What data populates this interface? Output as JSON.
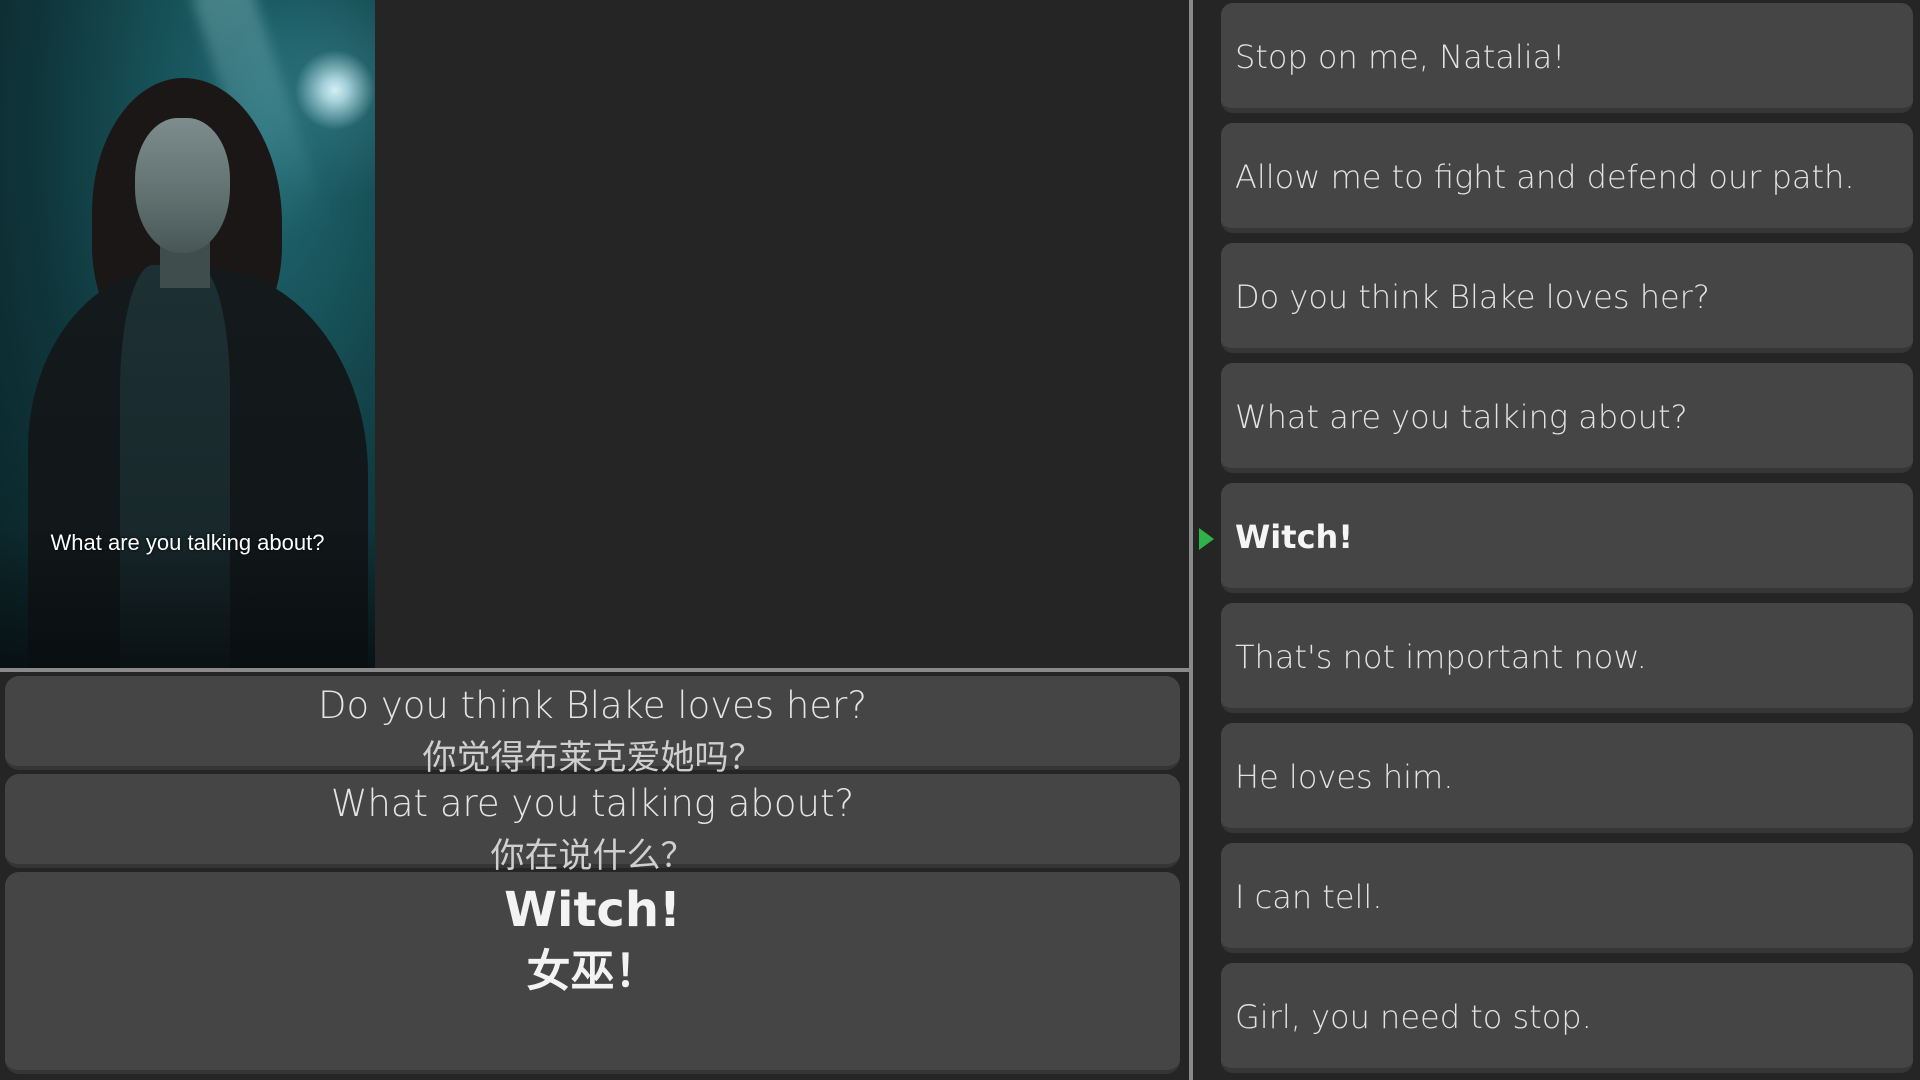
{
  "video": {
    "subtitle": "What are you talking about?"
  },
  "subtitle_panel": {
    "items": [
      {
        "en": "Do you think Blake loves her?",
        "zh": "你觉得布莱克爱她吗？"
      },
      {
        "en": "What are you talking about?",
        "zh": "你在说什么？"
      },
      {
        "en": "Witch!",
        "zh": "女巫！",
        "active": true
      }
    ]
  },
  "line_list": {
    "items": [
      {
        "text": "Stop on me, Natalia!"
      },
      {
        "text": "Allow me to fight and defend our path."
      },
      {
        "text": "Do you think Blake loves her?"
      },
      {
        "text": "What are you talking about?"
      },
      {
        "text": "Witch!",
        "current": true
      },
      {
        "text": "That's not important now."
      },
      {
        "text": "He loves him."
      },
      {
        "text": "I can tell."
      },
      {
        "text": "Girl, you need to stop."
      }
    ],
    "current_marker_icon": "play-triangle-icon",
    "marker_color": "#2fb24a"
  }
}
